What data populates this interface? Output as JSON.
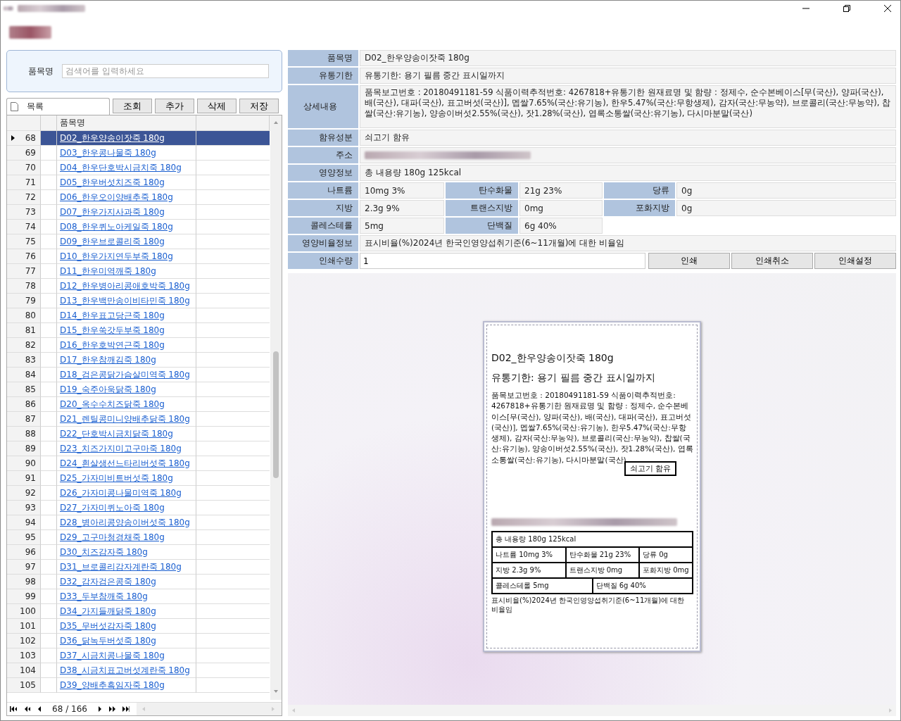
{
  "search": {
    "label": "품목명",
    "placeholder": "검색어를 입력하세요"
  },
  "list_tab": {
    "label": "목록"
  },
  "toolbar_buttons": [
    "조회",
    "추가",
    "삭제",
    "저장"
  ],
  "grid": {
    "columns": [
      "품목명"
    ],
    "rows": [
      {
        "number": "68",
        "name": "D02_한우양송이잣죽 180g",
        "selected": true
      },
      {
        "number": "69",
        "name": "D03_한우콩나물죽 180g",
        "selected": false
      },
      {
        "number": "70",
        "name": "D04_한우단호박시금치죽 180g",
        "selected": false
      },
      {
        "number": "71",
        "name": "D05_한우버섯치즈죽 180g",
        "selected": false
      },
      {
        "number": "72",
        "name": "D06_한우오이양배추죽 180g",
        "selected": false
      },
      {
        "number": "73",
        "name": "D07_한우가지사과죽 180g",
        "selected": false
      },
      {
        "number": "74",
        "name": "D08_한우퀴노아케일죽 180g",
        "selected": false
      },
      {
        "number": "75",
        "name": "D09_한우브로콜리죽 180g",
        "selected": false
      },
      {
        "number": "76",
        "name": "D10_한우가지연두부죽 180g",
        "selected": false
      },
      {
        "number": "77",
        "name": "D11_한우미역깨죽 180g",
        "selected": false
      },
      {
        "number": "78",
        "name": "D12_한우병아리콩애호박죽 180g",
        "selected": false
      },
      {
        "number": "79",
        "name": "D13_한우백만송이비타민죽 180g",
        "selected": false
      },
      {
        "number": "80",
        "name": "D14_한우표고당근죽 180g",
        "selected": false
      },
      {
        "number": "81",
        "name": "D15_한우쑥갓두부죽 180g",
        "selected": false
      },
      {
        "number": "82",
        "name": "D16_한우호박연근죽 180g",
        "selected": false
      },
      {
        "number": "83",
        "name": "D17_한우참깨김죽 180g",
        "selected": false
      },
      {
        "number": "84",
        "name": "D18_검은콩닭가슴살미역죽 180g",
        "selected": false
      },
      {
        "number": "85",
        "name": "D19_숙주아욱닭죽 180g",
        "selected": false
      },
      {
        "number": "86",
        "name": "D20_옥수수치즈닭죽 180g",
        "selected": false
      },
      {
        "number": "87",
        "name": "D21_렌틸콩미니양배추닭죽 180g",
        "selected": false
      },
      {
        "number": "88",
        "name": "D22_단호박시금치닭죽 180g",
        "selected": false
      },
      {
        "number": "89",
        "name": "D23_치즈가지미고구마죽 180g",
        "selected": false
      },
      {
        "number": "90",
        "name": "D24_흰살생선느타리버섯죽 180g",
        "selected": false
      },
      {
        "number": "91",
        "name": "D25_가자미비트버섯죽 180g",
        "selected": false
      },
      {
        "number": "92",
        "name": "D26_가자미콩나물미역죽 180g",
        "selected": false
      },
      {
        "number": "93",
        "name": "D27_가자미퀴노아죽 180g",
        "selected": false
      },
      {
        "number": "94",
        "name": "D28_병아리콩양송이버섯죽 180g",
        "selected": false
      },
      {
        "number": "95",
        "name": "D29_고구마청경채죽 180g",
        "selected": false
      },
      {
        "number": "96",
        "name": "D30_치즈감자죽 180g",
        "selected": false
      },
      {
        "number": "97",
        "name": "D31_브로콜리감자계란죽 180g",
        "selected": false
      },
      {
        "number": "98",
        "name": "D32_감자검은콩죽 180g",
        "selected": false
      },
      {
        "number": "99",
        "name": "D33_두부참깨죽 180g",
        "selected": false
      },
      {
        "number": "100",
        "name": "D34_가지들깨닭죽 180g",
        "selected": false
      },
      {
        "number": "101",
        "name": "D35_무버섯감자죽 180g",
        "selected": false
      },
      {
        "number": "102",
        "name": "D36_닭녹두버섯죽 180g",
        "selected": false
      },
      {
        "number": "103",
        "name": "D37_시금치콩나물죽 180g",
        "selected": false
      },
      {
        "number": "104",
        "name": "D38_시금치표고버섯계란죽 180g",
        "selected": false
      },
      {
        "number": "105",
        "name": "D39_양배추흑임자죽 180g",
        "selected": false
      }
    ]
  },
  "pager": {
    "position": "68 / 166"
  },
  "details": [
    {
      "kind": "single",
      "label": "품목명",
      "value": "D02_한우양송이잣죽 180g"
    },
    {
      "kind": "single",
      "label": "유통기한",
      "value": "유통기한: 용기 필름 중간 표시일까지"
    },
    {
      "kind": "tall",
      "label": "상세내용",
      "value": "품목보고번호 : 20180491181-59  식품이력추적번호: 4267818+유통기한   원재료명 및 함량 : 정제수, 순수본베이스[무(국산), 양파(국산), 배(국산), 대파(국산), 표고버섯(국산)], 멥쌀7.65%(국산:유기농), 한우5.47%(국산:무항생제), 감자(국산:무농약), 브로콜리(국산:무농약), 찹쌀(국산:유기농), 양송이버섯2.55%(국산), 잣1.28%(국산), 엽록소통쌀(국산:유기농), 다시마분말(국산)"
    },
    {
      "kind": "single",
      "label": "함유성분",
      "value": "쇠고기 함유"
    },
    {
      "kind": "redacted",
      "label": "주소"
    },
    {
      "kind": "single",
      "label": "영양정보",
      "value": "총 내용량 180g   125kcal"
    },
    {
      "kind": "triple",
      "cells": [
        {
          "label": "나트륨",
          "value": "10mg   3%"
        },
        {
          "label": "탄수화물",
          "value": "21g   23%"
        },
        {
          "label": "당류",
          "value": "0g"
        }
      ]
    },
    {
      "kind": "triple",
      "cells": [
        {
          "label": "지방",
          "value": "2.3g   9%"
        },
        {
          "label": "트랜스지방",
          "value": "0mg"
        },
        {
          "label": "포화지방",
          "value": "0g"
        }
      ]
    },
    {
      "kind": "triple",
      "cells": [
        {
          "label": "콜레스테롤",
          "value": "5mg"
        },
        {
          "label": "단백질",
          "value": "6g   40%"
        }
      ]
    },
    {
      "kind": "single",
      "label": "영양비율정보",
      "value": "표시비율(%)2024년 한국인영양섭취기준(6~11개월)에 대한 비율임"
    },
    {
      "kind": "print",
      "label": "인쇄수량",
      "value": "1",
      "buttons": [
        "인쇄",
        "인쇄취소",
        "인쇄설정"
      ]
    }
  ],
  "preview": {
    "title": "D02_한우양송이잣죽 180g",
    "shelf_life": "유통기한: 용기 필름 중간 표시일까지",
    "description": "품목보고번호 : 20180491181-59  식품이력추적번호: 4267818+유통기한   원재료명 및 함량 : 정제수, 순수본베이스[무(국산), 양파(국산), 배(국산), 대파(국산), 표고버섯(국산)], 멥쌀7.65%(국산:유기농), 한우5.47%(국산:무항생제), 감자(국산:무농약), 브로콜리(국산:무농약), 찹쌀(국산:유기농), 양송이버섯2.55%(국산), 잣1.28%(국산), 엽록소통쌀(국산:유기농), 다시마분말(국산)",
    "allergen": "쇠고기 함유",
    "nutrition": [
      [
        "총 내용량 180g   125kcal"
      ],
      [
        "나트륨  10mg   3%",
        "탄수화물  21g   23%",
        "당류  0g"
      ],
      [
        "지방  2.3g   9%",
        "트랜스지방  0mg",
        "포화지방  0mg"
      ],
      [
        "콜레스테롤  5mg",
        "단백질  6g   40%"
      ]
    ],
    "note": "표시비율(%)2024년 한국인영양섭취기준(6~11개월)에 대한 비율임"
  }
}
